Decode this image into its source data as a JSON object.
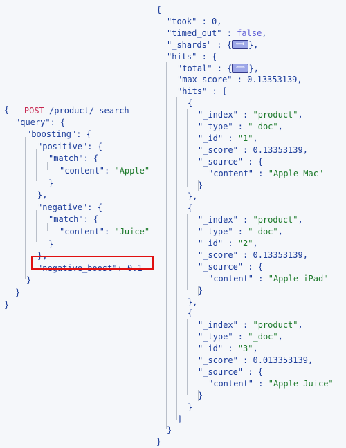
{
  "request": {
    "method": "POST",
    "path": "/product/_search",
    "lines": [
      {
        "indent": 0,
        "text": "{"
      },
      {
        "indent": 1,
        "key": "\"query\"",
        "rest": ": {"
      },
      {
        "indent": 2,
        "key": "\"boosting\"",
        "rest": ": {"
      },
      {
        "indent": 3,
        "key": "\"positive\"",
        "rest": ": {"
      },
      {
        "indent": 4,
        "key": "\"match\"",
        "rest": ": {"
      },
      {
        "indent": 5,
        "key": "\"content\"",
        "rest": ": ",
        "str": "\"Apple\""
      },
      {
        "indent": 4,
        "text": "}"
      },
      {
        "indent": 3,
        "text": "},"
      },
      {
        "indent": 3,
        "key": "\"negative\"",
        "rest": ": {"
      },
      {
        "indent": 4,
        "key": "\"match\"",
        "rest": ": {"
      },
      {
        "indent": 5,
        "key": "\"content\"",
        "rest": ": ",
        "str": "\"Juice\""
      },
      {
        "indent": 4,
        "text": "}"
      },
      {
        "indent": 3,
        "text": "},"
      },
      {
        "indent": 3,
        "key": "\"negative_boost\"",
        "rest": ": 0.1",
        "highlighted": true
      },
      {
        "indent": 2,
        "text": "}"
      },
      {
        "indent": 1,
        "text": "}"
      },
      {
        "indent": 0,
        "text": "}"
      }
    ]
  },
  "response": {
    "lines": [
      {
        "indent": 0,
        "text": "{"
      },
      {
        "indent": 1,
        "key": "\"took\"",
        "rest": " : 0,"
      },
      {
        "indent": 1,
        "key": "\"timed_out\"",
        "rest": " : ",
        "bool": "false",
        "tail": ","
      },
      {
        "indent": 1,
        "key": "\"_shards\"",
        "rest": " : {",
        "collapsed": true,
        "tail": "},"
      },
      {
        "indent": 1,
        "key": "\"hits\"",
        "rest": " : {"
      },
      {
        "indent": 2,
        "key": "\"total\"",
        "rest": " : {",
        "collapsed": true,
        "tail": "},"
      },
      {
        "indent": 2,
        "key": "\"max_score\"",
        "rest": " : 0.13353139,"
      },
      {
        "indent": 2,
        "key": "\"hits\"",
        "rest": " : ["
      },
      {
        "indent": 3,
        "text": "{"
      },
      {
        "indent": 4,
        "key": "\"_index\"",
        "rest": " : ",
        "str": "\"product\"",
        "tail": ","
      },
      {
        "indent": 4,
        "key": "\"_type\"",
        "rest": " : ",
        "str": "\"_doc\"",
        "tail": ","
      },
      {
        "indent": 4,
        "key": "\"_id\"",
        "rest": " : ",
        "str": "\"1\"",
        "tail": ","
      },
      {
        "indent": 4,
        "key": "\"_score\"",
        "rest": " : 0.13353139,"
      },
      {
        "indent": 4,
        "key": "\"_source\"",
        "rest": " : {"
      },
      {
        "indent": 5,
        "key": "\"content\"",
        "rest": " : ",
        "str": "\"Apple Mac\""
      },
      {
        "indent": 4,
        "text": "}"
      },
      {
        "indent": 3,
        "text": "},"
      },
      {
        "indent": 3,
        "text": "{"
      },
      {
        "indent": 4,
        "key": "\"_index\"",
        "rest": " : ",
        "str": "\"product\"",
        "tail": ","
      },
      {
        "indent": 4,
        "key": "\"_type\"",
        "rest": " : ",
        "str": "\"_doc\"",
        "tail": ","
      },
      {
        "indent": 4,
        "key": "\"_id\"",
        "rest": " : ",
        "str": "\"2\"",
        "tail": ","
      },
      {
        "indent": 4,
        "key": "\"_score\"",
        "rest": " : 0.13353139,"
      },
      {
        "indent": 4,
        "key": "\"_source\"",
        "rest": " : {"
      },
      {
        "indent": 5,
        "key": "\"content\"",
        "rest": " : ",
        "str": "\"Apple iPad\""
      },
      {
        "indent": 4,
        "text": "}"
      },
      {
        "indent": 3,
        "text": "},"
      },
      {
        "indent": 3,
        "text": "{"
      },
      {
        "indent": 4,
        "key": "\"_index\"",
        "rest": " : ",
        "str": "\"product\"",
        "tail": ","
      },
      {
        "indent": 4,
        "key": "\"_type\"",
        "rest": " : ",
        "str": "\"_doc\"",
        "tail": ","
      },
      {
        "indent": 4,
        "key": "\"_id\"",
        "rest": " : ",
        "str": "\"3\"",
        "tail": ","
      },
      {
        "indent": 4,
        "key": "\"_score\"",
        "rest": " : 0.013353139,"
      },
      {
        "indent": 4,
        "key": "\"_source\"",
        "rest": " : {"
      },
      {
        "indent": 5,
        "key": "\"content\"",
        "rest": " : ",
        "str": "\"Apple Juice\""
      },
      {
        "indent": 4,
        "text": "}"
      },
      {
        "indent": 3,
        "text": "}"
      },
      {
        "indent": 2,
        "text": "]"
      },
      {
        "indent": 1,
        "text": "}"
      },
      {
        "indent": 0,
        "text": "}"
      }
    ]
  }
}
